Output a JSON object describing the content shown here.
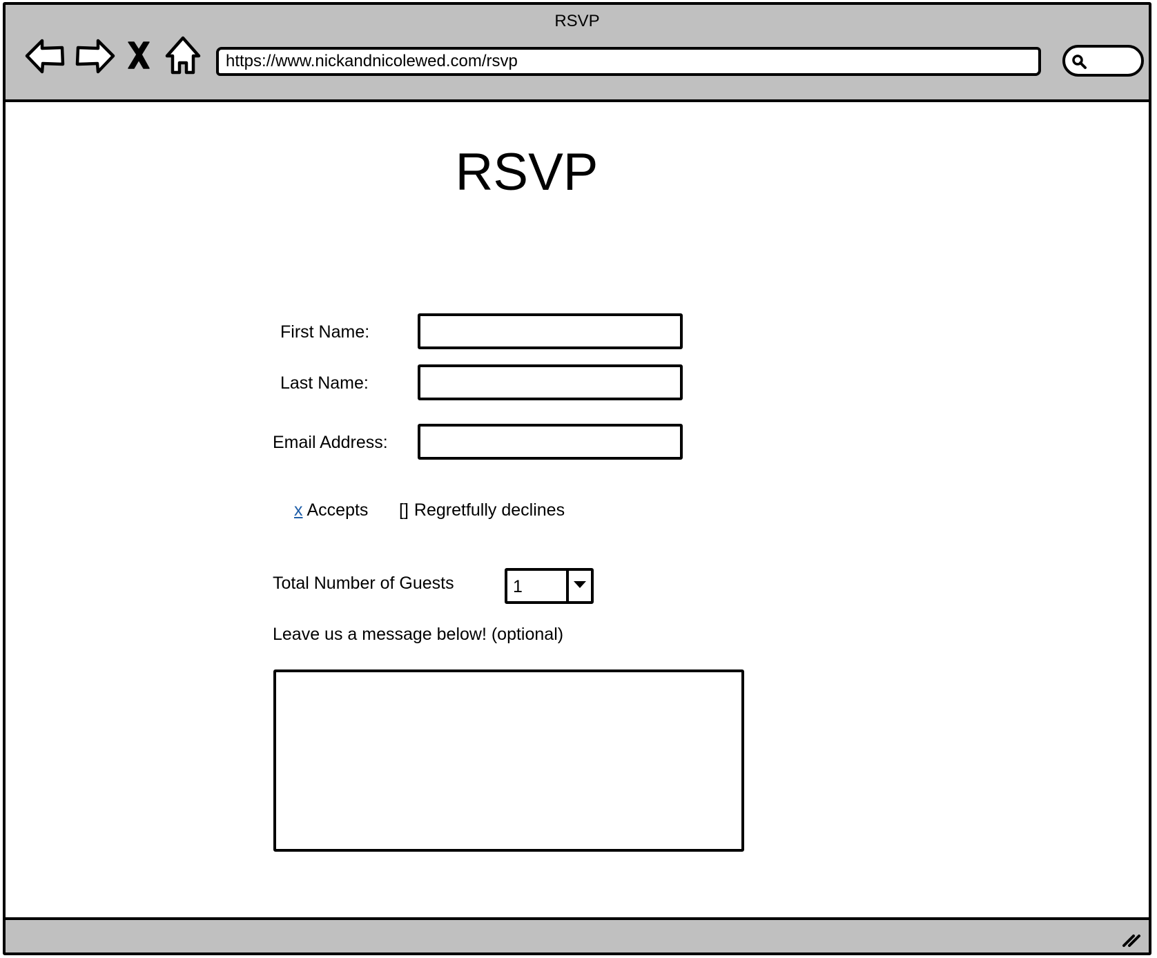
{
  "window": {
    "title": "RSVP"
  },
  "toolbar": {
    "back_icon": "back-arrow-icon",
    "forward_icon": "forward-arrow-icon",
    "stop_icon": "close-icon",
    "home_icon": "home-icon",
    "url": "https://www.nickandnicolewed.com/rsvp",
    "search_icon": "search-icon"
  },
  "page": {
    "title": "RSVP",
    "form": {
      "first_name_label": "First Name:",
      "first_name_value": "",
      "last_name_label": "Last Name:",
      "last_name_value": "",
      "email_label": "Email Address:",
      "email_value": "",
      "accepts_mark": "x",
      "accepts_label": "Accepts",
      "declines_mark": "[]",
      "declines_label": "Regretfully declines",
      "guests_label": "Total Number of Guests",
      "guests_value": "1",
      "message_label": "Leave us a message below! (optional)",
      "message_value": ""
    }
  },
  "colors": {
    "chrome_gray": "#c0c0c0",
    "link_blue": "#1f5ea8",
    "ink": "#000000"
  }
}
